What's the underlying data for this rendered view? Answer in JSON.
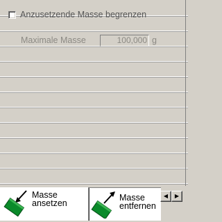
{
  "limit": {
    "checkbox_label": "Anzusetzende Masse begrenzen",
    "checked": false
  },
  "max_mass": {
    "label": "Maximale Masse",
    "value": "100,000",
    "unit": "g"
  },
  "tabs": [
    {
      "label_line1": "Masse",
      "label_line2": "ansetzen",
      "icon": "weight-add-icon",
      "selected": true
    },
    {
      "label_line1": "Masse",
      "label_line2": "entfernen",
      "icon": "weight-remove-icon",
      "selected": false
    }
  ],
  "scroll": {
    "left_glyph": "◀",
    "right_glyph": "▶"
  },
  "colors": {
    "panel": "#d4d0c8",
    "icon_green": "#0a8a2a",
    "disabled_text": "#8c8a84"
  }
}
